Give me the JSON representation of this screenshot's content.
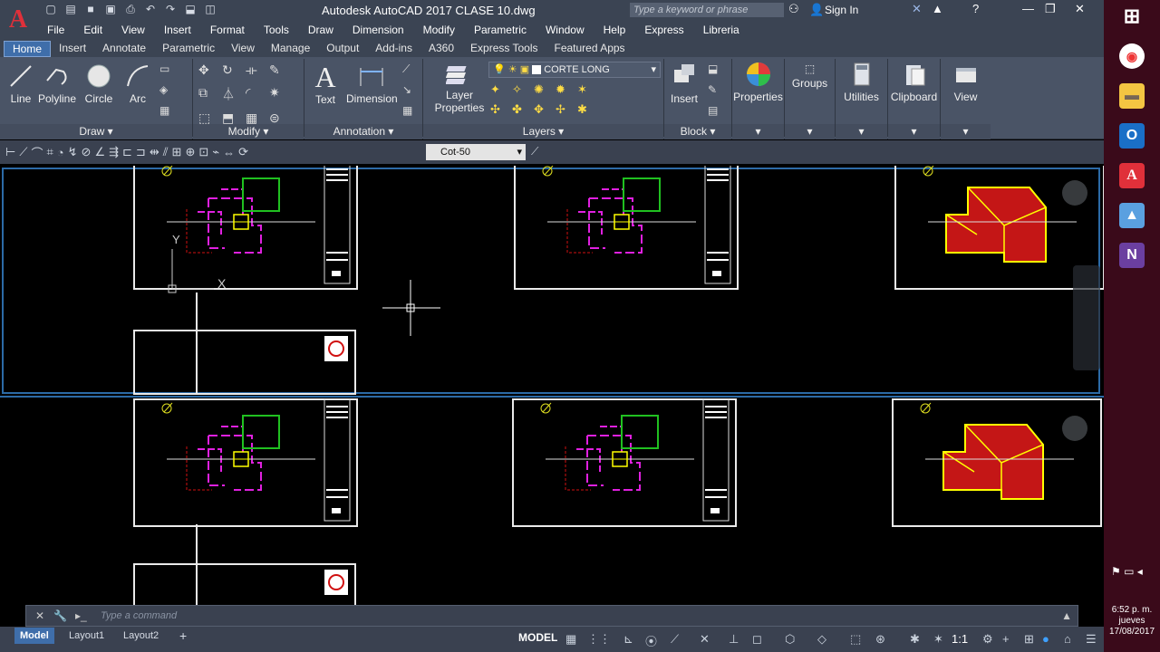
{
  "app": {
    "title": "Autodesk AutoCAD 2017    CLASE 10.dwg",
    "search_placeholder": "Type a keyword or phrase",
    "sign_in": "Sign In"
  },
  "menu": [
    "File",
    "Edit",
    "View",
    "Insert",
    "Format",
    "Tools",
    "Draw",
    "Dimension",
    "Modify",
    "Parametric",
    "Window",
    "Help",
    "Express",
    "Libreria"
  ],
  "ribbon_tabs": [
    "Home",
    "Insert",
    "Annotate",
    "Parametric",
    "View",
    "Manage",
    "Output",
    "Add-ins",
    "A360",
    "Express Tools",
    "Featured Apps"
  ],
  "ribbon": {
    "draw": {
      "title": "Draw",
      "line": "Line",
      "polyline": "Polyline",
      "circle": "Circle",
      "arc": "Arc"
    },
    "modify": {
      "title": "Modify"
    },
    "annotation": {
      "title": "Annotation",
      "text": "Text",
      "dimension": "Dimension"
    },
    "layers": {
      "title": "Layers",
      "layer_properties_l1": "Layer",
      "layer_properties_l2": "Properties",
      "current_layer": "CORTE LONG"
    },
    "block": {
      "title": "Block",
      "insert": "Insert"
    },
    "properties": "Properties",
    "groups": "Groups",
    "utilities": "Utilities",
    "clipboard": "Clipboard",
    "view": "View"
  },
  "dim_style": "Cot-50",
  "command_placeholder": "Type a command",
  "layout_tabs": {
    "model": "Model",
    "layout1": "Layout1",
    "layout2": "Layout2"
  },
  "status": {
    "space": "MODEL",
    "scale": "1:1"
  },
  "clock": {
    "time": "6:52 p. m.",
    "day": "jueves",
    "date": "17/08/2017"
  },
  "colors": {
    "accent": "#3f6eaa",
    "viewport_border": "#2c6aa6",
    "magenta": "#e020e0",
    "red": "#d01010",
    "yellow": "#ffff00",
    "green": "#20c020"
  }
}
